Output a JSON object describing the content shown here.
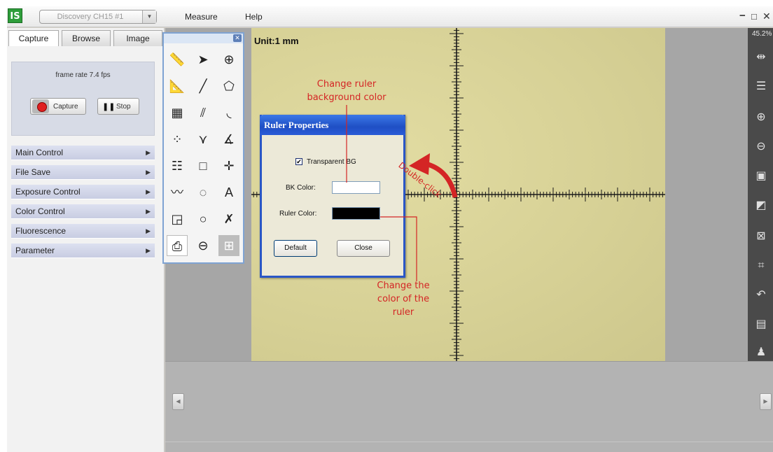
{
  "titlebar": {
    "logo": "IS",
    "camera_select": "Discovery CH15 #1",
    "menu": [
      "Measure",
      "Help"
    ],
    "window_controls": [
      "−",
      "□",
      "✕"
    ]
  },
  "left_panel": {
    "tabs": [
      "Capture",
      "Browse",
      "Image"
    ],
    "frame_rate": "frame rate 7.4 fps",
    "capture_button": "Capture",
    "stop_button": "Stop",
    "sections": [
      "Main Control",
      "File Save",
      "Exposure Control",
      "Color Control",
      "Fluorescence",
      "Parameter"
    ]
  },
  "canvas": {
    "unit": "Unit:1 mm",
    "zoom": "45.2%"
  },
  "dialog": {
    "title": "Ruler Properties",
    "transparent_bg_label": "Transparent BG",
    "transparent_bg_checked": true,
    "bk_color_label": "BK Color:",
    "bk_color_value": "#ffffff",
    "ruler_color_label": "Ruler Color:",
    "ruler_color_value": "#000000",
    "default_button": "Default",
    "close_button": "Close"
  },
  "annotations": {
    "bg_color_note": "Change ruler background color",
    "ruler_color_note": "Change the color of the ruler",
    "double_click": "Double-click"
  },
  "colors": {
    "annotation": "#d42525",
    "dialog_title": "#2a5bd7",
    "ruler": "#000000"
  },
  "palette_icons": [
    "ruler-tool-icon",
    "pointer-icon",
    "crosshair-circle-icon",
    "angle-ruler-icon",
    "line-icon",
    "polygon-icon",
    "grid-icon",
    "parallel-line-icon",
    "arc-icon",
    "point-count-icon",
    "two-line-angle-icon",
    "angle-icon",
    "table-icon",
    "rectangle-icon",
    "point-icon",
    "curve-icon",
    "dotted-circle-icon",
    "text-icon",
    "box-arrow-icon",
    "circle-icon",
    "mark-icon",
    "print-icon",
    "circle-line-icon",
    "grid-cross-icon"
  ]
}
